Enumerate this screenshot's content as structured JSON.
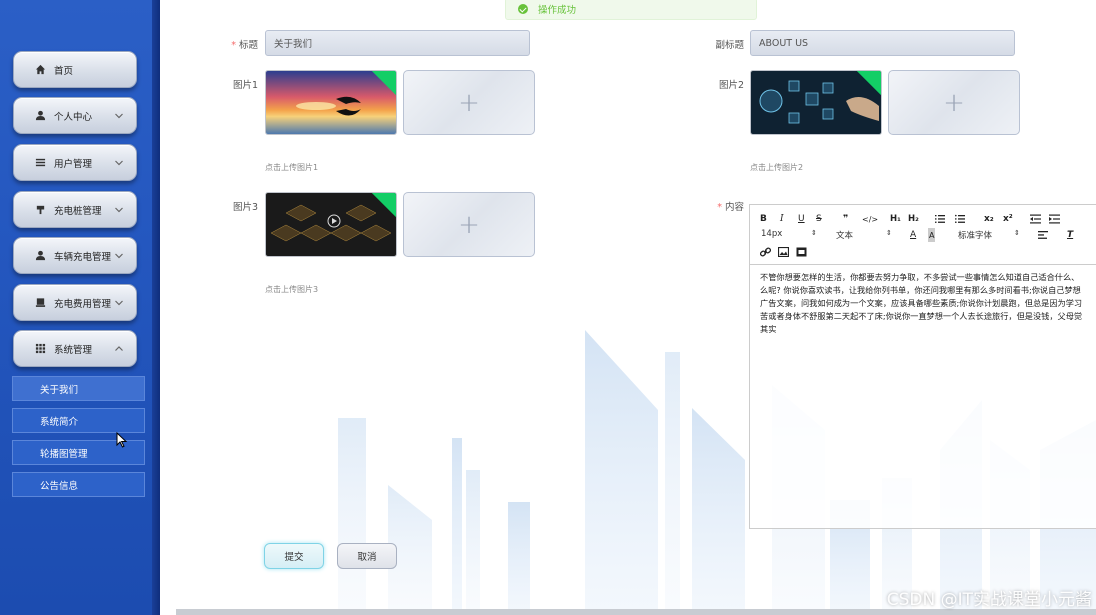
{
  "toast": {
    "message": "操作成功"
  },
  "sidebar": {
    "items": [
      {
        "label": "首页",
        "icon": "home-icon"
      },
      {
        "label": "个人中心",
        "icon": "user-icon"
      },
      {
        "label": "用户管理",
        "icon": "list-icon"
      },
      {
        "label": "充电桩管理",
        "icon": "plug-icon"
      },
      {
        "label": "车辆充电管理",
        "icon": "person-icon"
      },
      {
        "label": "充电费用管理",
        "icon": "card-icon"
      },
      {
        "label": "系统管理",
        "icon": "grid-icon"
      }
    ],
    "sub_items": [
      {
        "label": "关于我们"
      },
      {
        "label": "系统简介"
      },
      {
        "label": "轮播图管理"
      },
      {
        "label": "公告信息"
      }
    ]
  },
  "form": {
    "title_label": "标题",
    "title_value": "关于我们",
    "subtitle_label": "副标题",
    "subtitle_value": "ABOUT US",
    "pic1_label": "图片1",
    "pic1_hint": "点击上传图片1",
    "pic2_label": "图片2",
    "pic2_hint": "点击上传图片2",
    "pic3_label": "图片3",
    "pic3_hint": "点击上传图片3",
    "content_label": "内容",
    "submit_label": "提交",
    "cancel_label": "取消"
  },
  "editor": {
    "size_value": "14px",
    "text_value": "文本",
    "font_value": "标准字体",
    "content_lines": [
      "不管你想要怎样的生活，你都要去努力争取，不多尝试一些事情怎么知道自己适合什么、",
      "么呢? 你说你喜欢读书，让我给你列书单，你还问我哪里有那么多时间看书;你说自己梦想",
      "广告文案，问我如何成为一个文案，应该具备哪些素质;你说你计划晨跑，但总是因为学习",
      "苦或者身体不舒服第二天起不了床;你说你一直梦想一个人去长途旅行，但是没钱，父母觉",
      "其实"
    ]
  },
  "watermark": "CSDN @IT实战课堂小元酱",
  "colors": {
    "sidebar_blue": "#2457bf",
    "success_green": "#67c23a",
    "required_red": "#f56c6c"
  }
}
